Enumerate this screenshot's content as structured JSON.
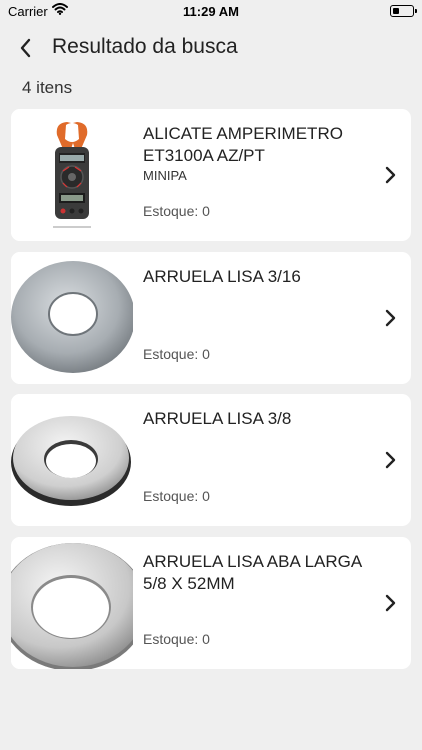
{
  "status_bar": {
    "carrier": "Carrier",
    "time": "11:29 AM"
  },
  "header": {
    "title": "Resultado da busca"
  },
  "results_count": "4 itens",
  "products": [
    {
      "name": "ALICATE AMPERIMETRO ET3100A AZ/PT",
      "brand": "MINIPA",
      "stock": "Estoque: 0",
      "image_icon": "clamp-meter"
    },
    {
      "name": "ARRUELA LISA 3/16",
      "brand": "",
      "stock": "Estoque: 0",
      "image_icon": "flat-washer"
    },
    {
      "name": "ARRUELA LISA 3/8",
      "brand": "",
      "stock": "Estoque: 0",
      "image_icon": "flat-washer"
    },
    {
      "name": "ARRUELA LISA ABA LARGA 5/8 X 52MM",
      "brand": "",
      "stock": "Estoque: 0",
      "image_icon": "flat-washer"
    }
  ]
}
